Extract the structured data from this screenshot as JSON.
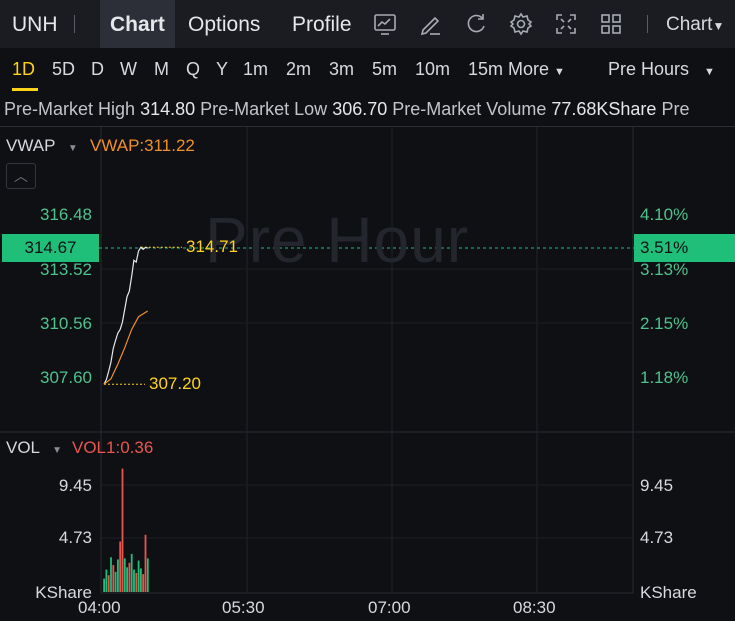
{
  "topbar": {
    "ticker": "UNH",
    "tabs": [
      "Chart",
      "Options",
      "Profile"
    ],
    "icons": [
      "chart-template-icon",
      "draw-icon",
      "refresh-icon",
      "settings-icon",
      "fullscreen-icon",
      "layout-grid-icon"
    ],
    "chart_dropdown": "Chart"
  },
  "periods": {
    "items": [
      "1D",
      "5D",
      "D",
      "W",
      "M",
      "Q",
      "Y",
      "1m",
      "2m",
      "3m",
      "5m",
      "10m",
      "15m"
    ],
    "active": "1D",
    "more_label": "More",
    "session_label": "Pre Hours"
  },
  "info": {
    "high_label": "Pre-Market High",
    "high_value": "314.80",
    "low_label": "Pre-Market Low",
    "low_value": "306.70",
    "volume_label": "Pre-Market Volume",
    "volume_value": "77.68KShare",
    "next_label": "Pre"
  },
  "main_chart": {
    "indicator": "VWAP",
    "indicator_value": "VWAP:311.22",
    "watermark": "Pre Hour",
    "current_price": "314.67",
    "current_pct": "3.51%",
    "high_marker": "314.71",
    "low_marker": "307.20",
    "y_left": [
      "316.48",
      "313.52",
      "310.56",
      "307.60"
    ],
    "y_right": [
      "4.10%",
      "3.13%",
      "2.15%",
      "1.18%"
    ]
  },
  "volume_chart": {
    "indicator": "VOL",
    "indicator_value": "VOL1:0.36",
    "y_left": [
      "9.45",
      "4.73",
      "KShare"
    ],
    "y_right": [
      "9.45",
      "4.73",
      "KShare"
    ]
  },
  "x_axis": [
    "04:00",
    "05:30",
    "07:00",
    "08:30"
  ],
  "colors": {
    "up": "#1fbf7a",
    "down": "#e9554f",
    "accent": "#ffd31a",
    "vwap": "#f0902a"
  },
  "chart_data": {
    "type": "line",
    "x_range": [
      "04:00",
      "09:30"
    ],
    "series": [
      {
        "values": [
          [
            0,
            307.2
          ],
          [
            1,
            307.45
          ],
          [
            2,
            307.9
          ],
          [
            3,
            308.4
          ],
          [
            4,
            309.15
          ],
          [
            5,
            309.6
          ],
          [
            6,
            310.0
          ],
          [
            7,
            310.2
          ],
          [
            8,
            310.6
          ],
          [
            9,
            311.3
          ],
          [
            10,
            312.0
          ],
          [
            11,
            312.3
          ],
          [
            12,
            313.1
          ],
          [
            13,
            314.0
          ],
          [
            14,
            313.9
          ],
          [
            15,
            314.5
          ],
          [
            16,
            314.71
          ],
          [
            17,
            314.6
          ],
          [
            18,
            314.7
          ],
          [
            19,
            314.67
          ]
        ]
      },
      {
        "name": "VWAP",
        "values": [
          [
            0,
            307.2
          ],
          [
            3,
            307.5
          ],
          [
            6,
            308.3
          ],
          [
            9,
            309.2
          ],
          [
            12,
            310.2
          ],
          [
            15,
            310.9
          ],
          [
            19,
            311.22
          ]
        ]
      }
    ],
    "volume": {
      "unit": "KShare",
      "values": [
        1.2,
        2.0,
        1.5,
        3.1,
        2.4,
        1.8,
        2.9,
        4.5,
        11.0,
        3.0,
        2.2,
        2.6,
        3.4,
        2.0,
        1.7,
        2.8,
        2.1,
        1.6,
        5.1,
        3.0
      ],
      "colors": [
        "up",
        "up",
        "down",
        "up",
        "down",
        "up",
        "up",
        "down",
        "down",
        "up",
        "up",
        "down",
        "up",
        "up",
        "down",
        "up",
        "up",
        "down",
        "down",
        "up"
      ]
    }
  }
}
